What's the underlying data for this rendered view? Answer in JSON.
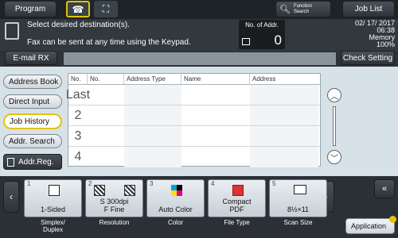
{
  "top": {
    "program": "Program",
    "function_search": "Function\nSearch",
    "job_list": "Job List"
  },
  "message": {
    "line1": "Select desired destination(s).",
    "line2": "Fax can be sent at any time using the Keypad.",
    "no_of_addr_label": "No. of Addr.",
    "no_of_addr_value": "0",
    "date": "02/ 17/ 2017",
    "time": "06:38",
    "memory_label": "Memory",
    "memory_value": "100%"
  },
  "buttons": {
    "email_rx": "E-mail RX",
    "check_setting": "Check Setting",
    "application": "Application"
  },
  "sidebar": {
    "items": [
      {
        "label": "Address Book"
      },
      {
        "label": "Direct Input"
      },
      {
        "label": "Job History"
      },
      {
        "label": "Addr. Search"
      },
      {
        "label": "Addr.Reg."
      }
    ]
  },
  "table": {
    "headers": [
      "No.",
      "No.",
      "Address Type",
      "Name",
      "Address"
    ],
    "rows": [
      {
        "no": "Last"
      },
      {
        "no": "2"
      },
      {
        "no": "3"
      },
      {
        "no": "4"
      }
    ]
  },
  "functions": [
    {
      "num": "1",
      "label": "1-Sided",
      "caption": "Simplex/\nDuplex"
    },
    {
      "num": "2",
      "label": "S 300dpi\nF Fine",
      "caption": "Resolution"
    },
    {
      "num": "3",
      "label": "Auto Color",
      "caption": "Color"
    },
    {
      "num": "4",
      "label": "Compact\nPDF",
      "caption": "File Type"
    },
    {
      "num": "5",
      "label": "8½×11",
      "caption": "Scan Size"
    }
  ],
  "colors": {
    "accent_yellow": "#e3c400",
    "panel_bg": "#d7e2e8"
  }
}
